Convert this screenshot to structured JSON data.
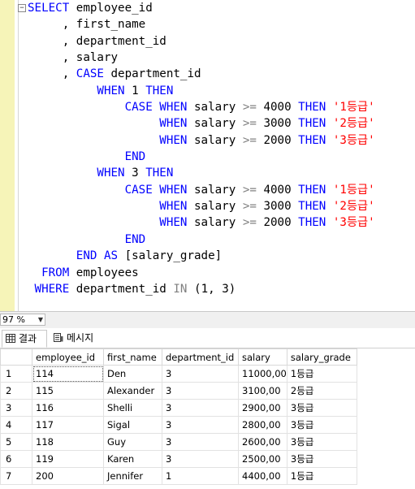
{
  "editor": {
    "lines": [
      [
        {
          "t": "SELECT",
          "c": "kw"
        },
        {
          "t": " employee_id",
          "c": ""
        }
      ],
      [
        {
          "t": "     , first_name",
          "c": ""
        }
      ],
      [
        {
          "t": "     , department_id",
          "c": ""
        }
      ],
      [
        {
          "t": "     , salary",
          "c": ""
        }
      ],
      [
        {
          "t": "     , ",
          "c": ""
        },
        {
          "t": "CASE",
          "c": "kw"
        },
        {
          "t": " department_id",
          "c": ""
        }
      ],
      [
        {
          "t": "          ",
          "c": ""
        },
        {
          "t": "WHEN",
          "c": "kw"
        },
        {
          "t": " 1 ",
          "c": ""
        },
        {
          "t": "THEN",
          "c": "kw"
        }
      ],
      [
        {
          "t": "              ",
          "c": ""
        },
        {
          "t": "CASE WHEN",
          "c": "kw"
        },
        {
          "t": " salary ",
          "c": ""
        },
        {
          "t": ">=",
          "c": "op"
        },
        {
          "t": " 4000 ",
          "c": ""
        },
        {
          "t": "THEN",
          "c": "kw"
        },
        {
          "t": " ",
          "c": ""
        },
        {
          "t": "'1등급'",
          "c": "str"
        }
      ],
      [
        {
          "t": "                   ",
          "c": ""
        },
        {
          "t": "WHEN",
          "c": "kw"
        },
        {
          "t": " salary ",
          "c": ""
        },
        {
          "t": ">=",
          "c": "op"
        },
        {
          "t": " 3000 ",
          "c": ""
        },
        {
          "t": "THEN",
          "c": "kw"
        },
        {
          "t": " ",
          "c": ""
        },
        {
          "t": "'2등급'",
          "c": "str"
        }
      ],
      [
        {
          "t": "                   ",
          "c": ""
        },
        {
          "t": "WHEN",
          "c": "kw"
        },
        {
          "t": " salary ",
          "c": ""
        },
        {
          "t": ">=",
          "c": "op"
        },
        {
          "t": " 2000 ",
          "c": ""
        },
        {
          "t": "THEN",
          "c": "kw"
        },
        {
          "t": " ",
          "c": ""
        },
        {
          "t": "'3등급'",
          "c": "str"
        }
      ],
      [
        {
          "t": "              ",
          "c": ""
        },
        {
          "t": "END",
          "c": "kw"
        }
      ],
      [
        {
          "t": "          ",
          "c": ""
        },
        {
          "t": "WHEN",
          "c": "kw"
        },
        {
          "t": " 3 ",
          "c": ""
        },
        {
          "t": "THEN",
          "c": "kw"
        }
      ],
      [
        {
          "t": "              ",
          "c": ""
        },
        {
          "t": "CASE WHEN",
          "c": "kw"
        },
        {
          "t": " salary ",
          "c": ""
        },
        {
          "t": ">=",
          "c": "op"
        },
        {
          "t": " 4000 ",
          "c": ""
        },
        {
          "t": "THEN",
          "c": "kw"
        },
        {
          "t": " ",
          "c": ""
        },
        {
          "t": "'1등급'",
          "c": "str"
        }
      ],
      [
        {
          "t": "                   ",
          "c": ""
        },
        {
          "t": "WHEN",
          "c": "kw"
        },
        {
          "t": " salary ",
          "c": ""
        },
        {
          "t": ">=",
          "c": "op"
        },
        {
          "t": " 3000 ",
          "c": ""
        },
        {
          "t": "THEN",
          "c": "kw"
        },
        {
          "t": " ",
          "c": ""
        },
        {
          "t": "'2등급'",
          "c": "str"
        }
      ],
      [
        {
          "t": "                   ",
          "c": ""
        },
        {
          "t": "WHEN",
          "c": "kw"
        },
        {
          "t": " salary ",
          "c": ""
        },
        {
          "t": ">=",
          "c": "op"
        },
        {
          "t": " 2000 ",
          "c": ""
        },
        {
          "t": "THEN",
          "c": "kw"
        },
        {
          "t": " ",
          "c": ""
        },
        {
          "t": "'3등급'",
          "c": "str"
        }
      ],
      [
        {
          "t": "              ",
          "c": ""
        },
        {
          "t": "END",
          "c": "kw"
        }
      ],
      [
        {
          "t": "       ",
          "c": ""
        },
        {
          "t": "END AS",
          "c": "kw"
        },
        {
          "t": " [salary_grade]",
          "c": ""
        }
      ],
      [
        {
          "t": "  ",
          "c": ""
        },
        {
          "t": "FROM",
          "c": "kw"
        },
        {
          "t": " employees",
          "c": ""
        }
      ],
      [
        {
          "t": " ",
          "c": ""
        },
        {
          "t": "WHERE",
          "c": "kw"
        },
        {
          "t": " department_id ",
          "c": ""
        },
        {
          "t": "IN",
          "c": "op"
        },
        {
          "t": " (1, 3)",
          "c": ""
        }
      ],
      [
        {
          "t": "",
          "c": ""
        }
      ]
    ],
    "collapse_symbol": "−"
  },
  "zoom": {
    "value": "97 %",
    "arrow": "▼"
  },
  "tabs": {
    "results_label": "결과",
    "messages_label": "메시지"
  },
  "grid": {
    "columns": [
      "employee_id",
      "first_name",
      "department_id",
      "salary",
      "salary_grade"
    ],
    "rows": [
      {
        "num": "1",
        "cells": [
          "114",
          "Den",
          "3",
          "11000,00",
          "1등급"
        ]
      },
      {
        "num": "2",
        "cells": [
          "115",
          "Alexander",
          "3",
          "3100,00",
          "2등급"
        ]
      },
      {
        "num": "3",
        "cells": [
          "116",
          "Shelli",
          "3",
          "2900,00",
          "3등급"
        ]
      },
      {
        "num": "4",
        "cells": [
          "117",
          "Sigal",
          "3",
          "2800,00",
          "3등급"
        ]
      },
      {
        "num": "5",
        "cells": [
          "118",
          "Guy",
          "3",
          "2600,00",
          "3등급"
        ]
      },
      {
        "num": "6",
        "cells": [
          "119",
          "Karen",
          "3",
          "2500,00",
          "3등급"
        ]
      },
      {
        "num": "7",
        "cells": [
          "200",
          "Jennifer",
          "1",
          "4400,00",
          "1등급"
        ]
      }
    ]
  },
  "colors": {
    "keyword": "#0000ff",
    "operator": "#808080",
    "string": "#ff0000",
    "gutter": "#f6f4b8"
  }
}
